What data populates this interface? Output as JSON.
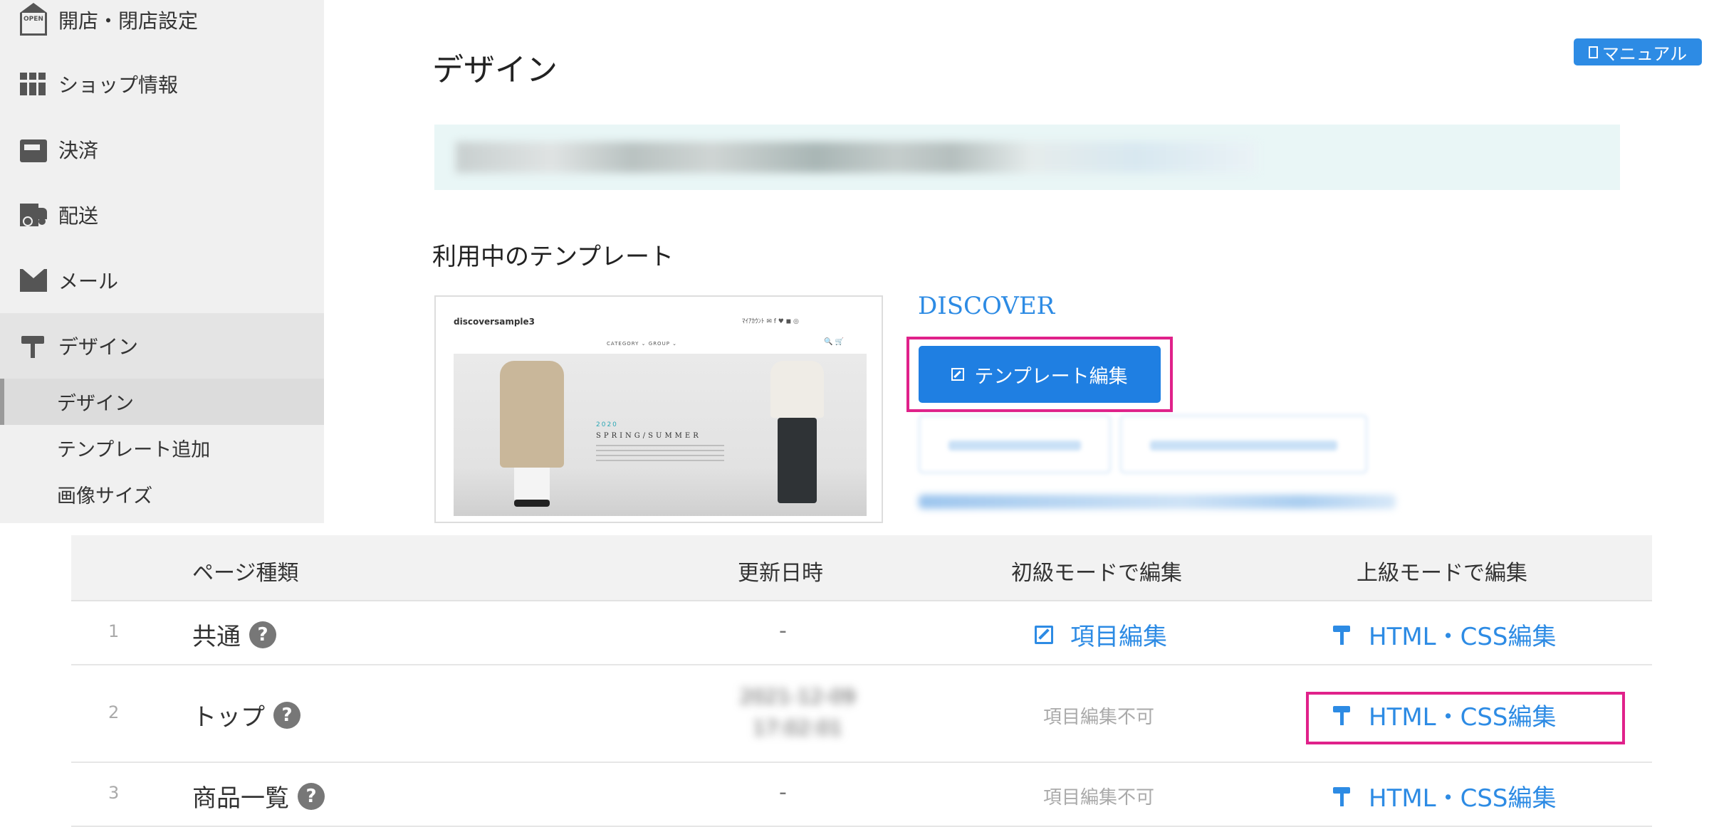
{
  "sidebar": {
    "items": [
      {
        "label": "開店・閉店設定",
        "icon": "open-sign-icon"
      },
      {
        "label": "ショップ情報",
        "icon": "shop-icon"
      },
      {
        "label": "決済",
        "icon": "payment-icon"
      },
      {
        "label": "配送",
        "icon": "truck-icon"
      },
      {
        "label": "メール",
        "icon": "mail-icon"
      },
      {
        "label": "デザイン",
        "icon": "paint-roller-icon"
      }
    ],
    "subitems": [
      {
        "label": "デザイン"
      },
      {
        "label": "テンプレート追加"
      },
      {
        "label": "画像サイズ"
      }
    ]
  },
  "main": {
    "title": "デザイン",
    "manual_label": "マニュアル",
    "section_title": "利用中のテンプレート",
    "template": {
      "name": "DISCOVER",
      "edit_label": "テンプレート編集",
      "preview": {
        "logo": "discoversample3",
        "top_right": "ﾏｲｱｶｳﾝﾄ  ✉ f ♥ ◼ ◎",
        "nav": "CATEGORY ⌄        GROUP ⌄",
        "search": "🔍  🛒",
        "year": "2020",
        "season": "SPRING/SUMMER"
      }
    }
  },
  "table": {
    "headers": {
      "page_type": "ページ種類",
      "updated": "更新日時",
      "basic": "初級モードで編集",
      "advanced": "上級モードで編集"
    },
    "rows": [
      {
        "num": "1",
        "name": "共通",
        "updated": "-",
        "basic": "項目編集",
        "advanced": "HTML・CSS編集"
      },
      {
        "num": "2",
        "name": "トップ",
        "updated_line1": "2021-12-09",
        "updated_line2": "17:02:01",
        "basic": "項目編集不可",
        "advanced": "HTML・CSS編集"
      },
      {
        "num": "3",
        "name": "商品一覧",
        "updated": "-",
        "basic": "項目編集不可",
        "advanced": "HTML・CSS編集"
      }
    ],
    "help_symbol": "?"
  },
  "colors": {
    "accent": "#2d8be4",
    "highlight": "#e0218a",
    "sidebar_bg": "#f0f0f0",
    "notice_bg": "#e9f6f6"
  }
}
